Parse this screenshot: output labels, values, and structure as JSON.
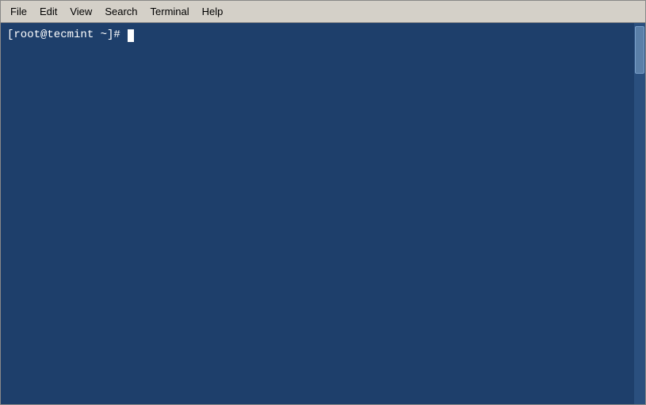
{
  "menubar": {
    "items": [
      {
        "id": "file",
        "label": "File"
      },
      {
        "id": "edit",
        "label": "Edit"
      },
      {
        "id": "view",
        "label": "View"
      },
      {
        "id": "search",
        "label": "Search"
      },
      {
        "id": "terminal",
        "label": "Terminal"
      },
      {
        "id": "help",
        "label": "Help"
      }
    ]
  },
  "terminal": {
    "prompt": "[root@tecmint ~]# ",
    "cursor_char": ""
  }
}
